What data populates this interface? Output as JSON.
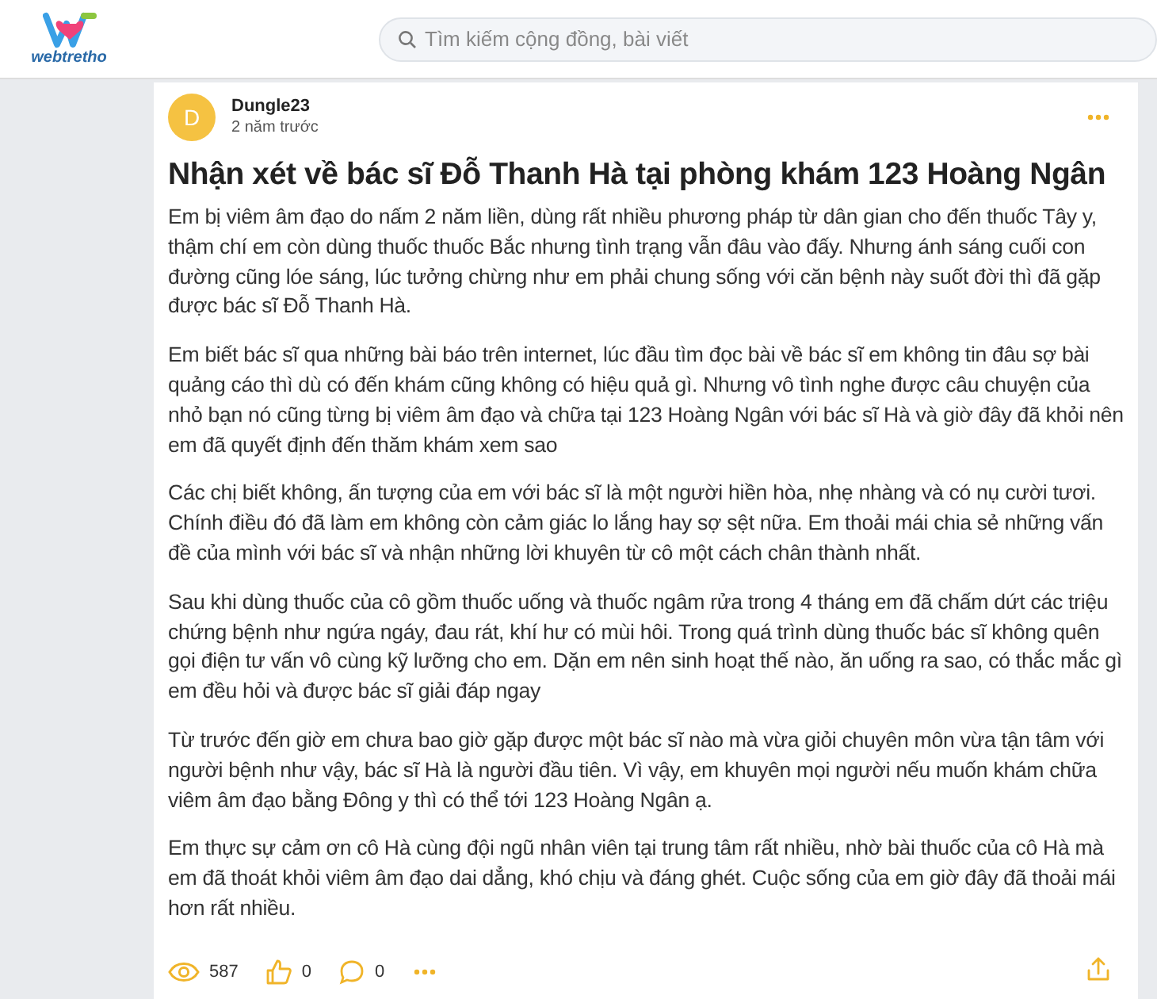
{
  "header": {
    "logo_text": "webtretho",
    "search": {
      "placeholder": "Tìm kiếm cộng đồng, bài viết"
    }
  },
  "post": {
    "author": {
      "initial": "D",
      "name": "Dungle23"
    },
    "time": "2 năm trước",
    "title": "Nhận xét về bác sĩ Đỗ Thanh Hà tại phòng khám 123 Hoàng Ngân",
    "paragraphs": [
      "Em bị viêm âm đạo do nấm 2 năm liền, dùng rất nhiều phương pháp từ dân gian cho đến thuốc Tây y, thậm chí em còn dùng thuốc thuốc Bắc nhưng tình trạng vẫn đâu vào đấy. Nhưng ánh sáng cuối con đường cũng lóe sáng, lúc tưởng chừng như em phải chung sống với căn bệnh này suốt đời thì đã gặp được bác sĩ Đỗ Thanh Hà.",
      "Em biết bác sĩ qua những bài báo trên internet, lúc đầu tìm đọc bài về bác sĩ em không tin đâu sợ bài quảng cáo thì dù có đến khám cũng không có hiệu quả gì. Nhưng vô tình nghe được câu chuyện của nhỏ bạn nó cũng từng bị viêm âm đạo và chữa tại 123 Hoàng Ngân với bác sĩ Hà và giờ đây đã khỏi nên em đã quyết định đến thăm khám xem sao",
      "Các chị biết không, ấn tượng của em với bác sĩ là một người hiền hòa, nhẹ nhàng và có nụ cười tươi. Chính điều đó đã làm em không còn cảm giác lo lắng hay sợ sệt nữa. Em thoải mái chia sẻ những vấn đề của mình với bác sĩ và nhận những lời khuyên từ cô một cách chân thành nhất.",
      "Sau khi dùng thuốc của cô gồm thuốc uống và thuốc ngâm rửa trong 4 tháng em đã chấm dứt các triệu chứng bệnh như ngứa ngáy, đau rát, khí hư có mùi hôi. Trong quá trình dùng thuốc bác sĩ không quên gọi điện tư vấn vô cùng kỹ lưỡng cho em. Dặn em nên sinh hoạt thế nào, ăn uống ra sao, có thắc mắc gì em đều hỏi và được bác sĩ giải đáp ngay",
      "Từ trước đến giờ em chưa bao giờ gặp được một bác sĩ nào mà vừa giỏi chuyên môn vừa tận tâm với người bệnh như vậy, bác sĩ Hà là người đầu tiên. Vì vậy, em khuyên mọi người nếu muốn khám chữa viêm âm đạo bằng Đông y thì có thể tới 123 Hoàng Ngân ạ.",
      "Em thực sự cảm ơn cô Hà cùng đội ngũ nhân viên tại trung tâm rất nhiều, nhờ bài thuốc của cô Hà mà em đã thoát khỏi viêm âm đạo dai dẳng, khó chịu và đáng ghét. Cuộc sống của em giờ đây đã thoải mái hơn rất nhiều."
    ],
    "stats": [
      {
        "kind": "views",
        "count": "587"
      },
      {
        "kind": "likes",
        "count": "0"
      },
      {
        "kind": "comments",
        "count": "0"
      }
    ]
  }
}
